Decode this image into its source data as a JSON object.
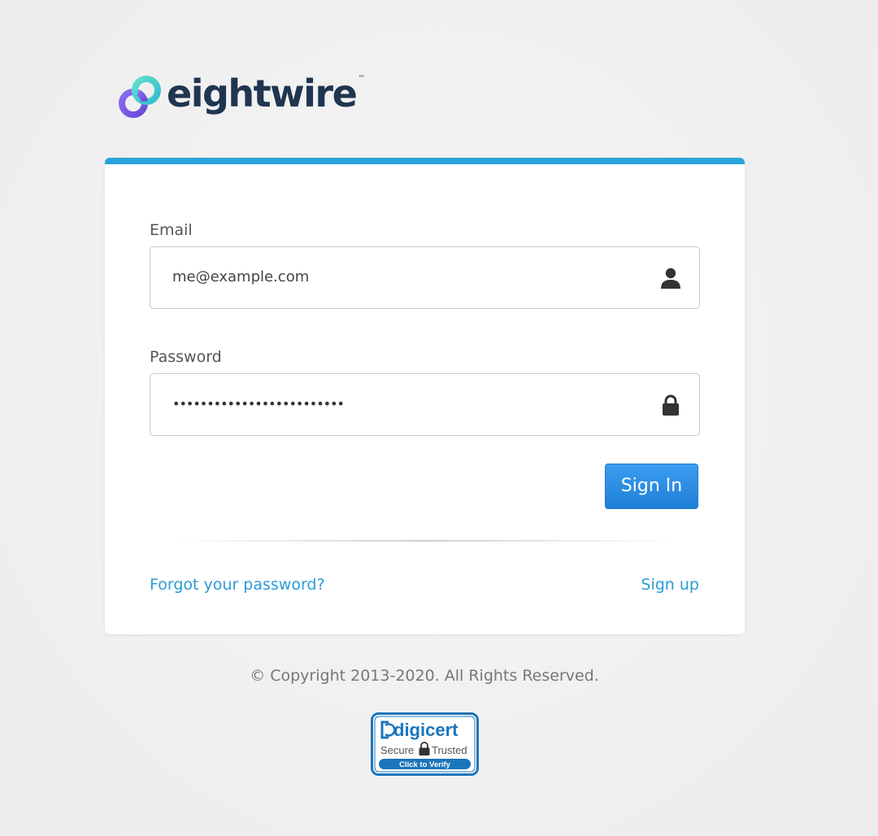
{
  "brand": {
    "name": "eightwire",
    "trademark": "™",
    "colors": {
      "wordmark": "#1f3550",
      "mark_purple": "#7a5be6",
      "mark_teal": "#3fd0c0"
    }
  },
  "form": {
    "accent_color": "#2aa4dc",
    "email": {
      "label": "Email",
      "value": "me@example.com",
      "icon": "user-icon"
    },
    "password": {
      "label": "Password",
      "value": "•••••••••••••••••••••••••",
      "icon": "lock-icon"
    },
    "submit_label": "Sign In",
    "forgot_password_label": "Forgot your password?",
    "sign_up_label": "Sign up"
  },
  "footer": {
    "copyright": "© Copyright 2013-2020. All Rights Reserved.",
    "seal": {
      "brand": "digicert",
      "line1_left": "Secure",
      "line1_right": "Trusted",
      "cta": "Click to Verify"
    }
  }
}
